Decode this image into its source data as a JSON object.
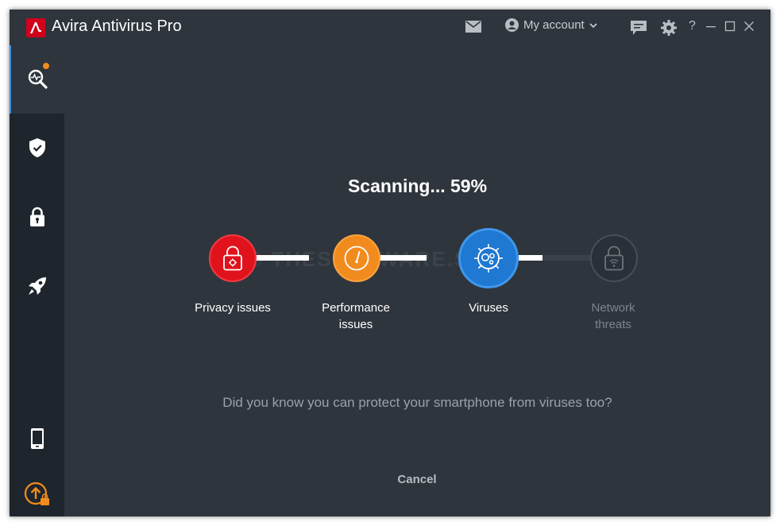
{
  "app": {
    "brand": "Avira",
    "product": "Antivirus Pro"
  },
  "titlebar": {
    "mail_icon": "mail-icon",
    "account_label": "My account",
    "help_label": "?"
  },
  "sidebar": {
    "items": [
      {
        "name": "scan",
        "icon": "scan-icon",
        "active": true
      },
      {
        "name": "protection",
        "icon": "shield-check-icon"
      },
      {
        "name": "privacy",
        "icon": "lock-icon"
      },
      {
        "name": "performance",
        "icon": "rocket-icon"
      },
      {
        "name": "mobile",
        "icon": "phone-icon"
      },
      {
        "name": "upgrade",
        "icon": "upgrade-icon"
      }
    ]
  },
  "scan": {
    "status_prefix": "Scanning... ",
    "percent_label": "59%",
    "progress_percent": 59,
    "steps": [
      {
        "label_line1": "Privacy issues",
        "label_line2": "",
        "state": "done",
        "color": "#e0131d"
      },
      {
        "label_line1": "Performance",
        "label_line2": "issues",
        "state": "done",
        "color": "#f28b1d"
      },
      {
        "label_line1": "Viruses",
        "label_line2": "",
        "state": "active",
        "color": "#1f78d1"
      },
      {
        "label_line1": "Network",
        "label_line2": "threats",
        "state": "pending",
        "color": "#2a3037"
      }
    ],
    "tip": "Did you know you can protect your smartphone from viruses too?",
    "cancel_label": "Cancel"
  },
  "watermark": "© THESOFTWARE.SHOP",
  "colors": {
    "accent_red": "#d0021b",
    "window_bg": "#2f353d",
    "sidebar_bg": "#1f252c",
    "active_blue": "#1f78d1",
    "notification_orange": "#f28b1d"
  }
}
